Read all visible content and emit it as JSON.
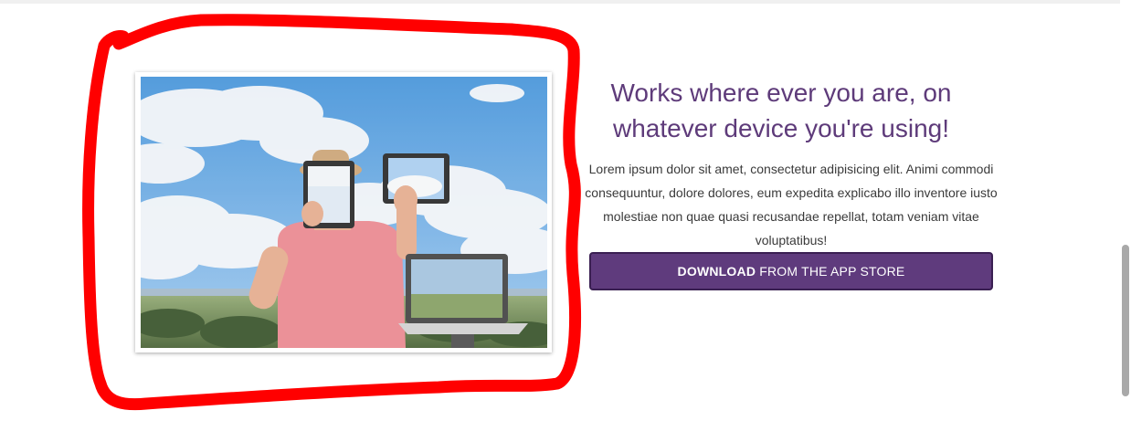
{
  "section": {
    "image_alt": "Person holding tablets and a laptop in front of a sky",
    "headline": "Works where ever you are, on whatever device you're using!",
    "body": "Lorem ipsum dolor sit amet, consectetur adipisicing elit. Animi commodi consequuntur, dolore dolores, eum expedita explicabo illo inventore iusto molestiae non quae quasi recusandae repellat, totam veniam vitae voluptatibus!",
    "button": {
      "bold": "DOWNLOAD",
      "rest": " FROM THE APP STORE"
    }
  },
  "colors": {
    "accent": "#5f3b7d",
    "headline": "#5e3b7a",
    "annotation": "#ff0000"
  },
  "scrollbar": {
    "position_fraction": 0.58
  }
}
